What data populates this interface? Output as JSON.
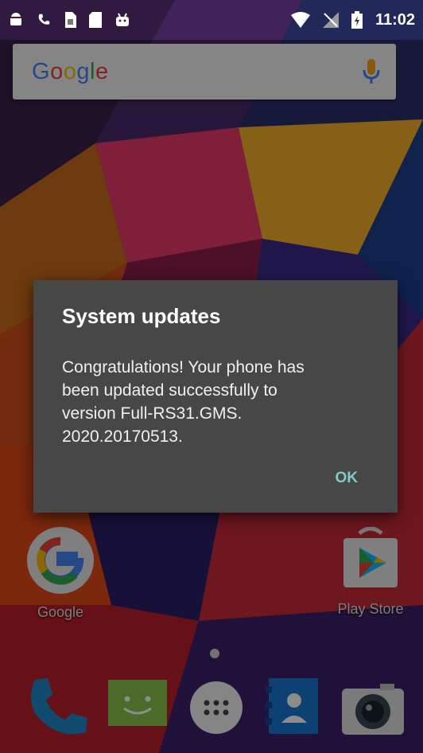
{
  "status_bar": {
    "time": "11:02",
    "left_icons": [
      "android-icon",
      "phone-icon",
      "sim-icon",
      "sd-card-icon",
      "android-debug-icon"
    ],
    "right_icons": [
      "wifi-icon",
      "no-signal-icon",
      "battery-charging-icon"
    ]
  },
  "search": {
    "logo": "Google",
    "colors": [
      "#4285f4",
      "#ea4335",
      "#fbbc05",
      "#4285f4",
      "#34a853",
      "#ea4335"
    ],
    "mic_color": "#f4a21c"
  },
  "dialog": {
    "title": "System updates",
    "message": "Congratulations! Your phone has been updated successfully to version Full-RS31.GMS. 2020.20170513.",
    "ok_label": "OK"
  },
  "apps": {
    "google_label": "Google",
    "play_store_label": "Play Store"
  },
  "dock": [
    "phone-icon",
    "messaging-icon",
    "app-drawer-icon",
    "contacts-icon",
    "camera-icon"
  ]
}
